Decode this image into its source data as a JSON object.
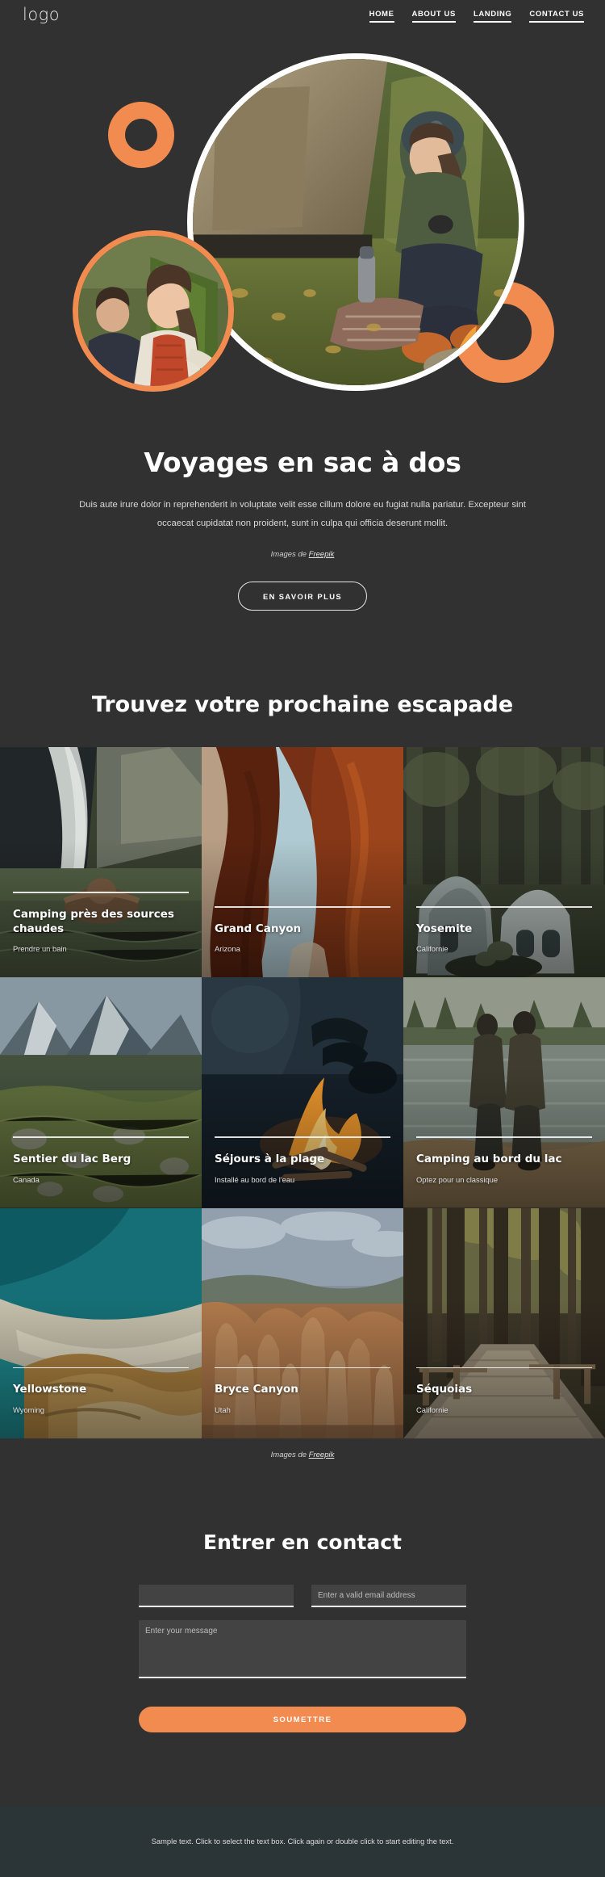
{
  "header": {
    "logo": "logo",
    "nav": [
      {
        "label": "HOME"
      },
      {
        "label": "ABOUT US"
      },
      {
        "label": "LANDING"
      },
      {
        "label": "CONTACT US"
      }
    ]
  },
  "hero": {
    "title": "Voyages en sac à dos",
    "subtitle": "Duis aute irure dolor in reprehenderit in voluptate velit esse cillum dolore eu fugiat nulla pariatur. Excepteur sint occaecat cupidatat non proident, sunt in culpa qui officia deserunt mollit.",
    "credit_prefix": "Images de ",
    "credit_link": "Freepik",
    "cta": "EN SAVOIR PLUS"
  },
  "gallery": {
    "title": "Trouvez votre prochaine escapade",
    "credit_prefix": "Images de ",
    "credit_link": "Freepik",
    "cards": [
      {
        "title": "Camping près des sources chaudes",
        "subtitle": "Prendre un bain"
      },
      {
        "title": "Grand Canyon",
        "subtitle": "Arizona"
      },
      {
        "title": "Yosemite",
        "subtitle": "Californie"
      },
      {
        "title": "Sentier du lac Berg",
        "subtitle": "Canada"
      },
      {
        "title": "Séjours à la plage",
        "subtitle": "Installé au bord de l'eau"
      },
      {
        "title": "Camping au bord du lac",
        "subtitle": "Optez pour un classique"
      },
      {
        "title": "Yellowstone",
        "subtitle": "Wyoming"
      },
      {
        "title": "Bryce Canyon",
        "subtitle": "Utah"
      },
      {
        "title": "Séquoias",
        "subtitle": "Californie"
      }
    ]
  },
  "contact": {
    "title": "Entrer en contact",
    "name_value": "",
    "name_placeholder": "",
    "email_placeholder": "Enter a valid email address",
    "message_placeholder": "Enter your message",
    "submit": "SOUMETTRE"
  },
  "footer": {
    "text": "Sample text. Click to select the text box. Click again or double click to start editing the text."
  },
  "colors": {
    "background": "#313131",
    "accent": "#f18b50",
    "footer_background": "#2b3436",
    "text": "#ffffff"
  }
}
